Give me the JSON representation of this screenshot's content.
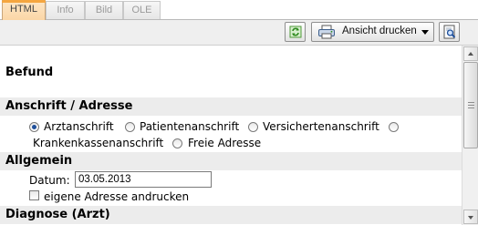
{
  "tabs": [
    {
      "label": "HTML",
      "active": true
    },
    {
      "label": "Info",
      "active": false
    },
    {
      "label": "Bild",
      "active": false
    },
    {
      "label": "OLE",
      "active": false
    }
  ],
  "toolbar": {
    "refresh_icon": "refresh-icon",
    "print_label": "Ansicht drucken",
    "print_icon": "printer-icon",
    "preview_icon": "print-preview-icon"
  },
  "sections": {
    "befund": "Befund",
    "anschrift": "Anschrift / Adresse",
    "allgemein": "Allgemein",
    "diagnose": "Diagnose (Arzt)"
  },
  "address_options": [
    {
      "label": "Arztanschrift",
      "checked": true
    },
    {
      "label": "Patientenanschrift",
      "checked": false
    },
    {
      "label": "Versichertenanschrift",
      "checked": false
    },
    {
      "label": "Krankenkassenanschrift",
      "checked": false
    },
    {
      "label": "Freie Adresse",
      "checked": false
    }
  ],
  "allgemein": {
    "date_label": "Datum:",
    "date_value": "03.05.2013",
    "own_address_label": "eigene Adresse andrucken",
    "own_address_checked": false
  },
  "colors": {
    "active_tab_accent": "#f5a640",
    "section_bar": "#ececec"
  }
}
